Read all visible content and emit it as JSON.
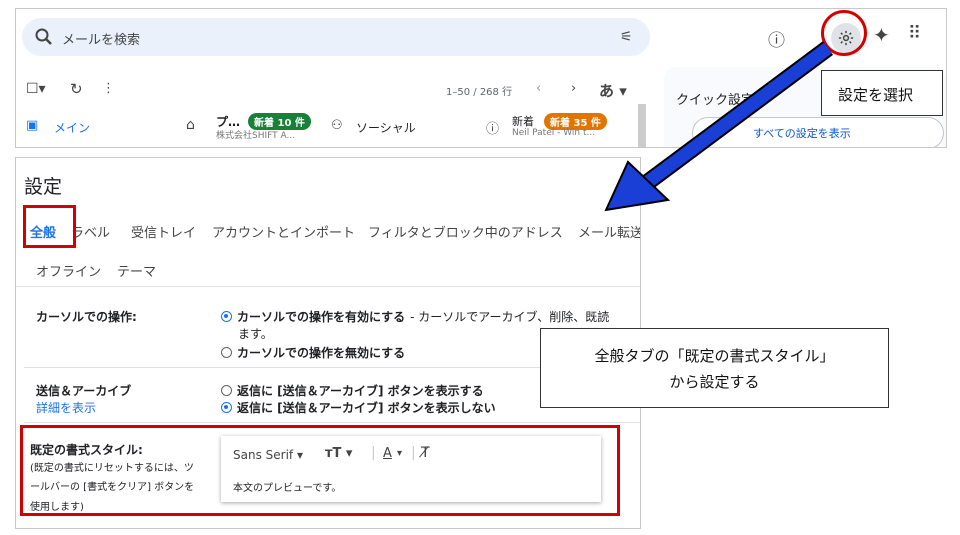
{
  "search": {
    "placeholder": "メールを検索"
  },
  "toolbar": {
    "range": "1–50 / 268 行",
    "input_tool": "あ"
  },
  "inbox": {
    "main_tab": "メイン",
    "promo_label": "プ…",
    "promo_badge": "新着 10 件",
    "promo_sender": "株式会社SHIFT A...",
    "social_label": "ソーシャル",
    "updates_label": "新着",
    "updates_badge": "新着 35 件",
    "updates_sender": "Neil Patel - Win t..."
  },
  "quick_settings": {
    "title": "クイック設定",
    "show_all": "すべての設定を表示"
  },
  "callouts": {
    "select_settings": "設定を選択",
    "general_tab_line1": "全般タブの「既定の書式スタイル」",
    "general_tab_line2": "から設定する"
  },
  "settings": {
    "title": "設定",
    "tabs": [
      "全般",
      "ラベル",
      "受信トレイ",
      "アカウントとインポート",
      "フィルタとブロック中のアドレス",
      "メール転送"
    ],
    "tabs_row2": [
      "オフライン",
      "テーマ"
    ],
    "cursor": {
      "label": "カーソルでの操作:",
      "opt1_bold": "カーソルでの操作を有効にする",
      "opt1_rest": " - カーソルでアーカイブ、削除、既読",
      "opt1_cont": "ます。",
      "opt2": "カーソルでの操作を無効にする"
    },
    "send_archive": {
      "label": "送信＆アーカイブ",
      "link": "詳細を表示",
      "opt1": "返信に [送信＆アーカイブ] ボタンを表示する",
      "opt2": "返信に [送信＆アーカイブ] ボタンを表示しない"
    },
    "default_style": {
      "label": "既定の書式スタイル:",
      "note1": "(既定の書式にリセットするには、ツ",
      "note2": "ールバーの [書式をクリア] ボタンを",
      "note3": "使用します)",
      "font": "Sans Serif",
      "preview": "本文のプレビューです。"
    }
  },
  "colors": {
    "highlight": "#d40000",
    "arrow": "#1a3fd6",
    "accent": "#1a73e8"
  }
}
